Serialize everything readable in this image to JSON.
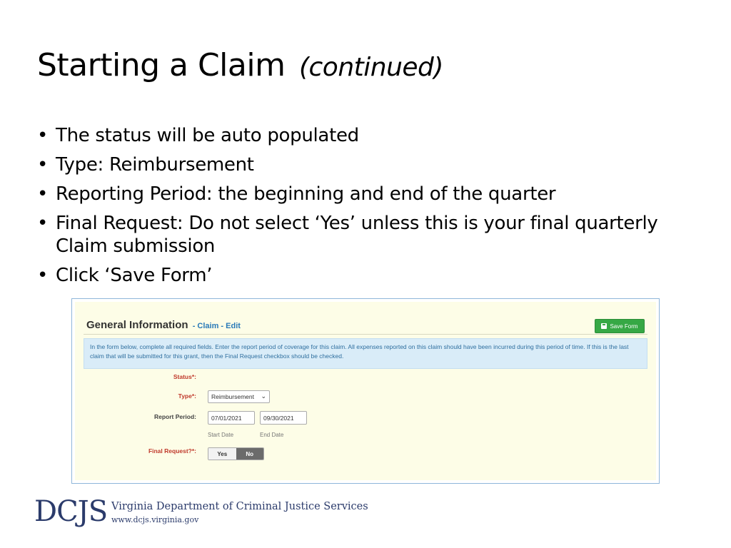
{
  "slide": {
    "title": "Starting a Claim",
    "title_suffix": "(continued)",
    "bullets": [
      "The status will be auto populated",
      "Type: Reimbursement",
      "Reporting Period: the beginning and end of the quarter",
      "Final Request: Do not select ‘Yes’ unless this is your final quarterly Claim submission",
      "Click ‘Save Form’"
    ]
  },
  "form": {
    "title": "General Information",
    "breadcrumb": "- Claim - Edit",
    "save_label": "Save Form",
    "info_text": "In the form below, complete all required fields. Enter the report period of coverage for this claim. All expenses reported on this claim should have been incurred during this period of time. If this is the last claim that will be submitted for this grant, then the Final Request checkbox should be checked.",
    "status_label": "Status*:",
    "type_label": "Type*:",
    "type_value": "Reimbursement",
    "report_period_label": "Report Period:",
    "start_date": "07/01/2021",
    "end_date": "09/30/2021",
    "start_hint": "Start Date",
    "end_hint": "End Date",
    "final_request_label": "Final Request?*:",
    "yes_label": "Yes",
    "no_label": "No"
  },
  "footer": {
    "logo_text": "DCJS",
    "org_name": "Virginia Department of Criminal Justice Services",
    "org_url": "www.dcjs.virginia.gov"
  },
  "colors": {
    "accent_blue": "#2a7ab8",
    "save_green": "#36a845",
    "required_red": "#c0392b",
    "form_bg": "#fdfde7",
    "info_bg": "#d9ecf8",
    "logo_navy": "#2b3b6b"
  }
}
